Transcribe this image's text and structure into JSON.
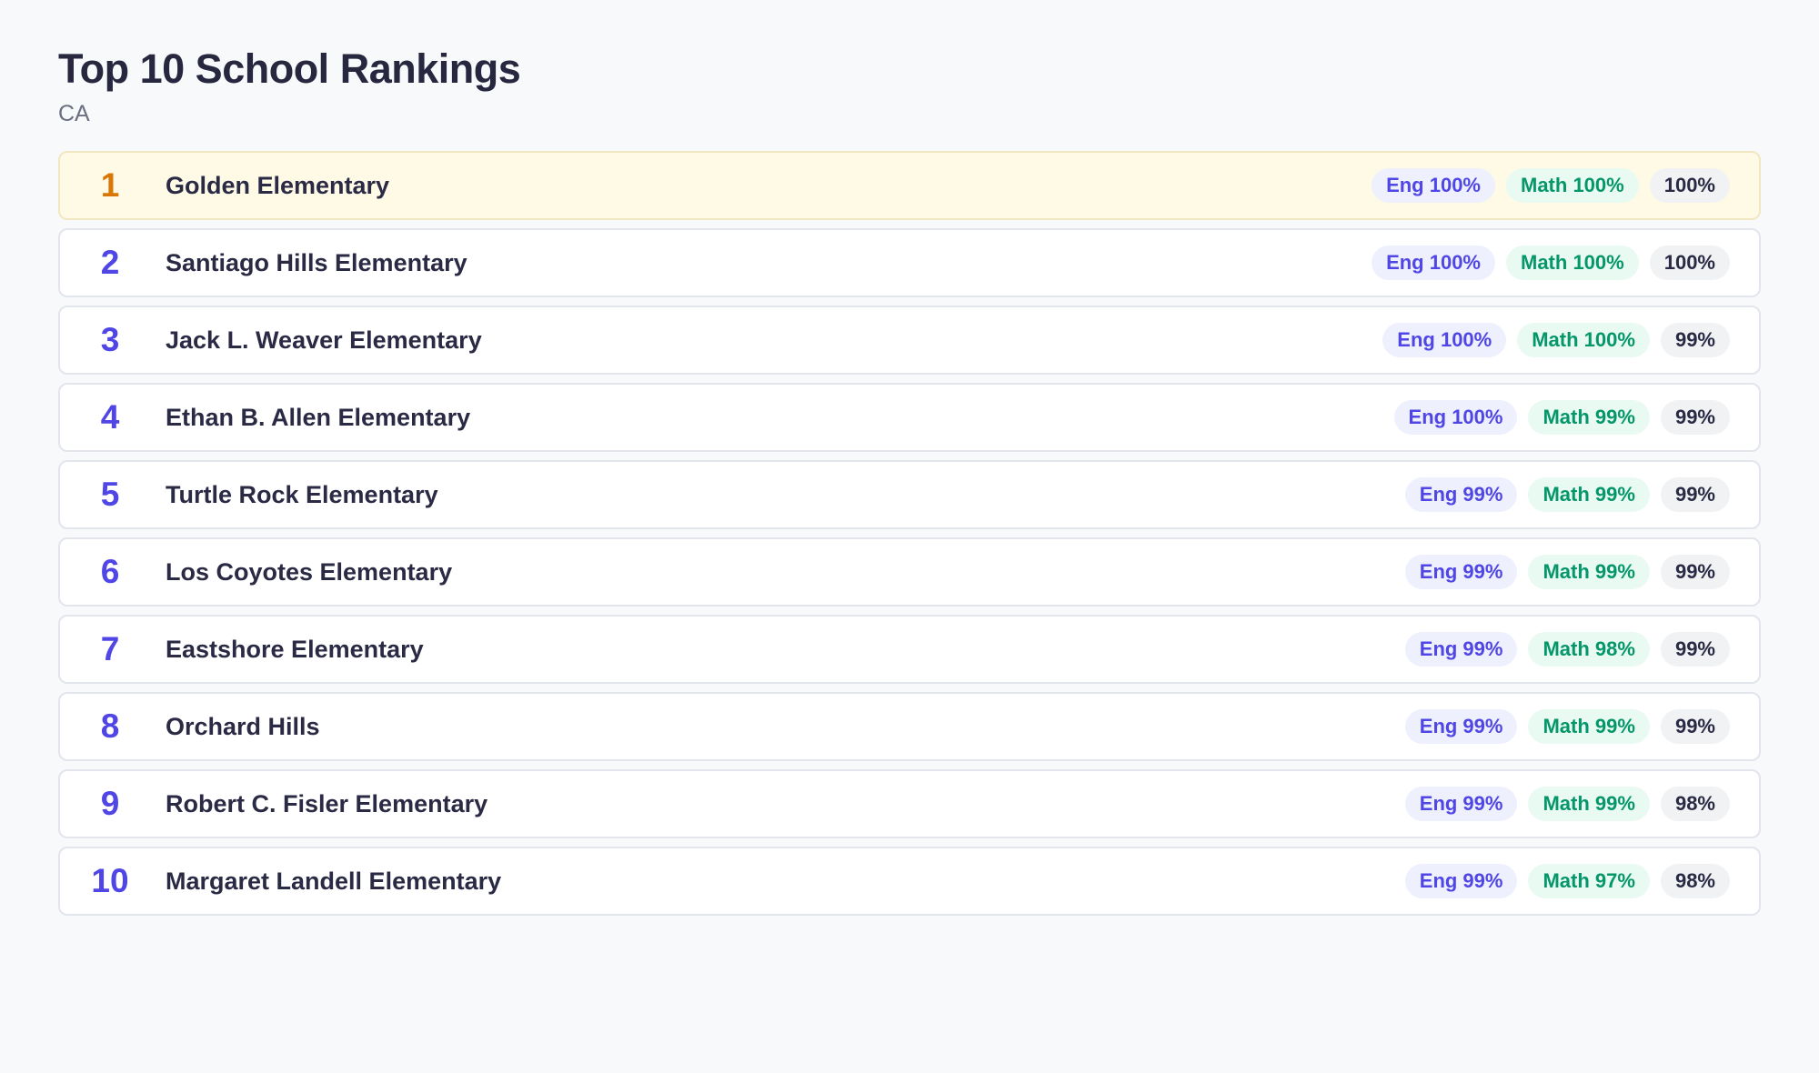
{
  "header": {
    "title": "Top 10 School Rankings",
    "subtitle": "CA"
  },
  "colors": {
    "accent": "#4f46e5",
    "top_rank": "#d97706",
    "math": "#059669",
    "top_row_bg": "#fffae6"
  },
  "schools": [
    {
      "rank": "1",
      "name": "Golden Elementary",
      "eng": "Eng 100%",
      "math": "Math 100%",
      "overall": "100%"
    },
    {
      "rank": "2",
      "name": "Santiago Hills Elementary",
      "eng": "Eng 100%",
      "math": "Math 100%",
      "overall": "100%"
    },
    {
      "rank": "3",
      "name": "Jack L. Weaver Elementary",
      "eng": "Eng 100%",
      "math": "Math 100%",
      "overall": "99%"
    },
    {
      "rank": "4",
      "name": "Ethan B. Allen Elementary",
      "eng": "Eng 100%",
      "math": "Math 99%",
      "overall": "99%"
    },
    {
      "rank": "5",
      "name": "Turtle Rock Elementary",
      "eng": "Eng 99%",
      "math": "Math 99%",
      "overall": "99%"
    },
    {
      "rank": "6",
      "name": "Los Coyotes Elementary",
      "eng": "Eng 99%",
      "math": "Math 99%",
      "overall": "99%"
    },
    {
      "rank": "7",
      "name": "Eastshore Elementary",
      "eng": "Eng 99%",
      "math": "Math 98%",
      "overall": "99%"
    },
    {
      "rank": "8",
      "name": "Orchard Hills",
      "eng": "Eng 99%",
      "math": "Math 99%",
      "overall": "99%"
    },
    {
      "rank": "9",
      "name": "Robert C. Fisler Elementary",
      "eng": "Eng 99%",
      "math": "Math 99%",
      "overall": "98%"
    },
    {
      "rank": "10",
      "name": "Margaret Landell Elementary",
      "eng": "Eng 99%",
      "math": "Math 97%",
      "overall": "98%"
    }
  ]
}
